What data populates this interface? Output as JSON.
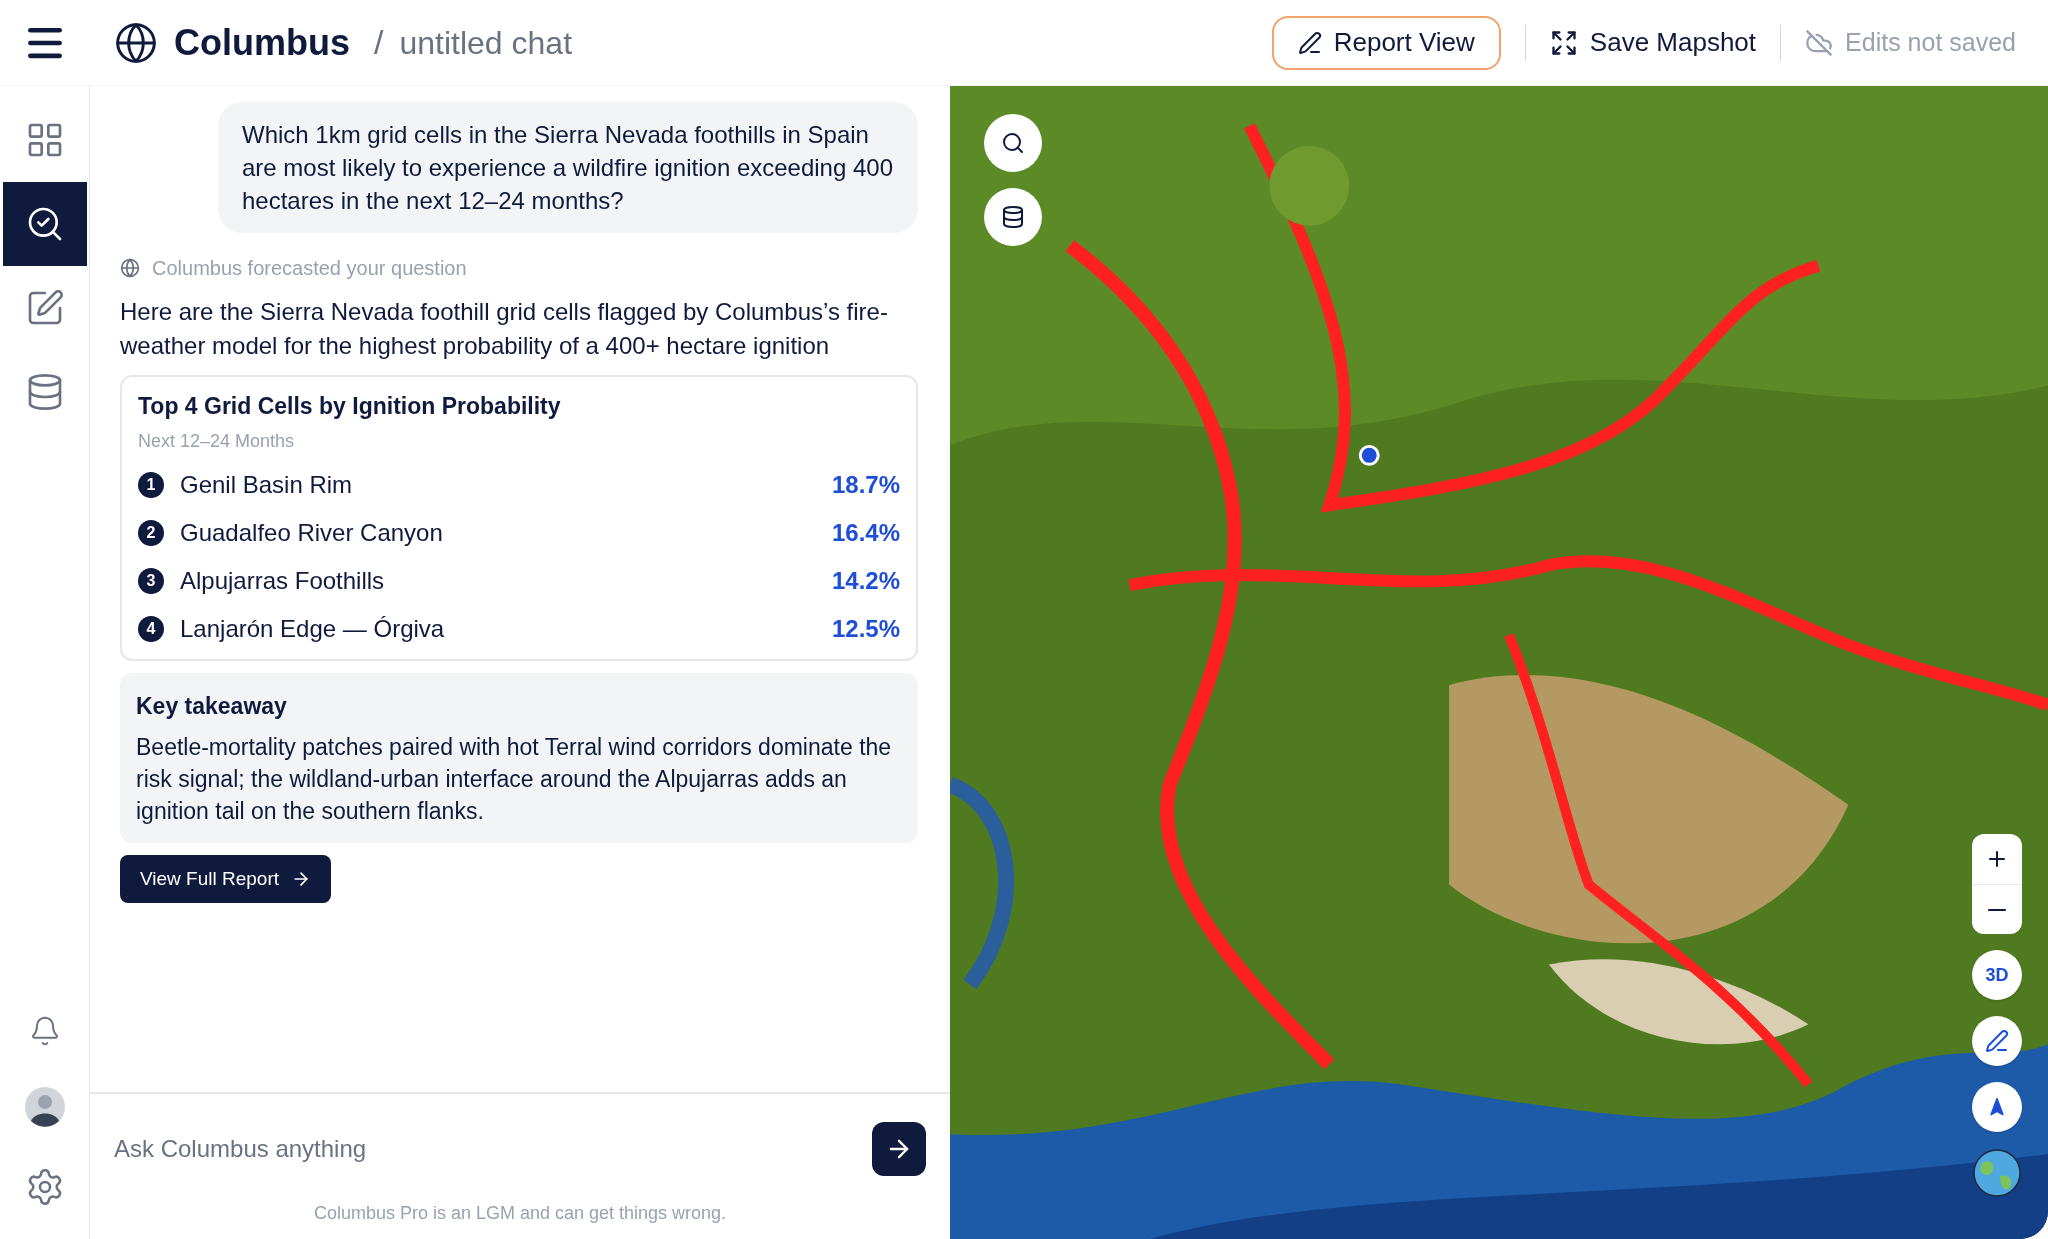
{
  "header": {
    "brand": "Columbus",
    "separator": "/",
    "chat_title": "untitled chat",
    "actions": [
      {
        "kind": "report",
        "label": "Report View"
      },
      {
        "kind": "mapshot",
        "label": "Save Mapshot"
      }
    ],
    "save_status": {
      "label": "Edits not saved",
      "saved": false
    }
  },
  "sidebar": {
    "items": [
      {
        "kind": "grid",
        "selected": false
      },
      {
        "kind": "explore",
        "selected": true
      },
      {
        "kind": "edit",
        "selected": false
      },
      {
        "kind": "database",
        "selected": false
      }
    ],
    "bottom": [
      {
        "kind": "bell"
      },
      {
        "kind": "avatar"
      },
      {
        "kind": "settings"
      }
    ]
  },
  "chat": {
    "question": "Which 1km grid cells in the Sierra Nevada foothills in Spain are most likely to experience a wildfire ignition exceeding 400 hectares in the next 12–24 months?",
    "status": "Columbus forecasted your question",
    "answer": "Here are the Sierra Nevada foothill grid cells flagged by Columbus’s fire-weather model for the highest probability of a 400+ hectare ignition",
    "ranking": {
      "title": "Top 4 Grid Cells by Ignition Probability",
      "subtitle": "Next 12–24 Months",
      "rows": [
        {
          "rank": "1",
          "name": "Genil Basin Rim",
          "probability": "18.7%"
        },
        {
          "rank": "2",
          "name": "Guadalfeo River Canyon",
          "probability": "16.4%"
        },
        {
          "rank": "3",
          "name": "Alpujarras Foothills",
          "probability": "14.2%"
        },
        {
          "rank": "4",
          "name": "Lanjarón Edge — Órgiva",
          "probability": "12.5%"
        }
      ]
    },
    "takeaway": {
      "title": "Key takeaway",
      "text": "Beetle-mortality patches paired with hot Terral wind corridors dominate the risk signal; the wildland-urban interface around the Alpujarras adds an ignition tail on the southern flanks."
    },
    "report_button": "View Full Report",
    "input": {
      "placeholder": "Ask Columbus anything"
    },
    "disclaimer": "Columbus Pro is an LGM and can get things wrong."
  },
  "map": {
    "kind": "picture",
    "top_controls": [
      {
        "kind": "search"
      },
      {
        "kind": "database"
      }
    ],
    "zoom_controls": [
      {
        "kind": "plus"
      },
      {
        "kind": "minus"
      }
    ],
    "round_controls": [
      {
        "kind": "text",
        "label": "3D"
      },
      {
        "kind": "pen"
      },
      {
        "kind": "north"
      },
      {
        "kind": "globe"
      }
    ]
  }
}
